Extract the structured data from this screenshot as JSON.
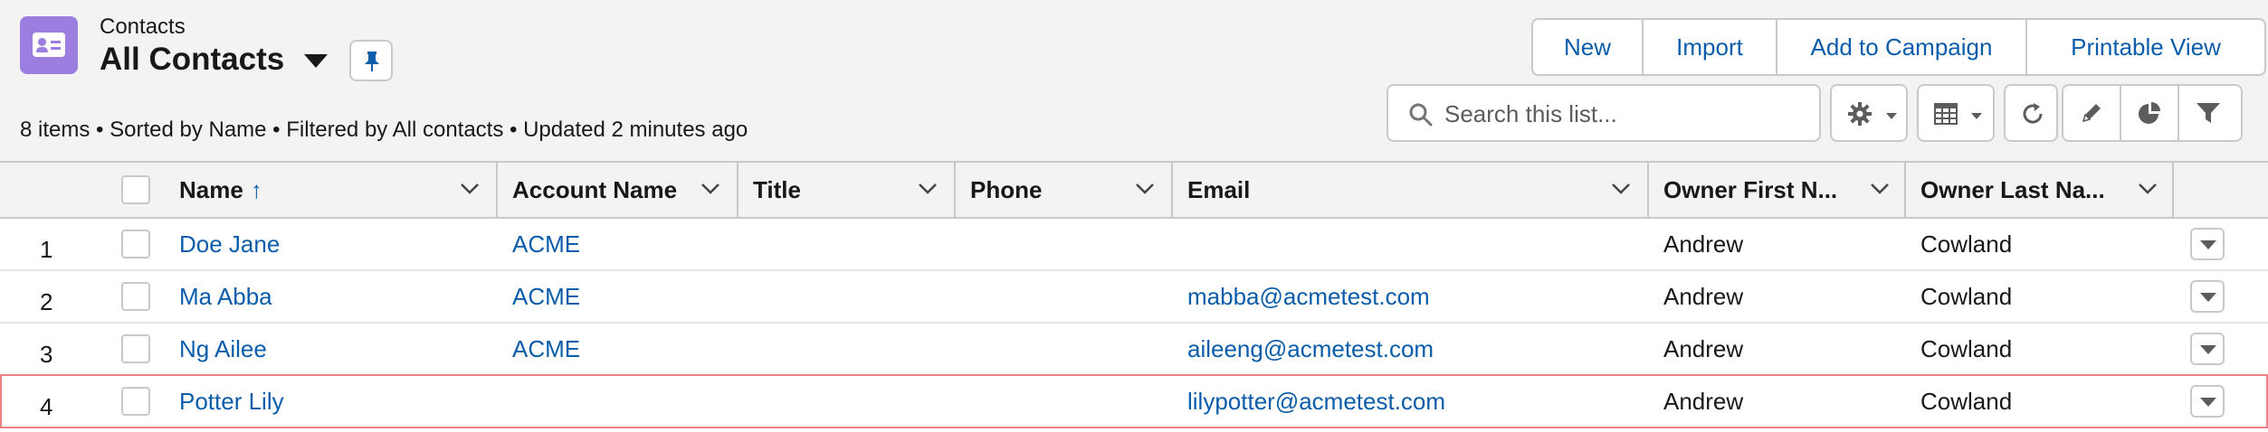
{
  "header": {
    "object_label": "Contacts",
    "list_view_title": "All Contacts",
    "summary": "8 items • Sorted by Name • Filtered by All contacts • Updated 2 minutes ago",
    "buttons": {
      "new": "New",
      "import": "Import",
      "add_to_campaign": "Add to Campaign",
      "printable_view": "Printable View"
    },
    "search_placeholder": "Search this list...",
    "toolbar_icons": [
      "gear-icon",
      "table-icon",
      "refresh-icon",
      "pencil-icon",
      "pie-chart-icon",
      "filter-icon"
    ]
  },
  "table": {
    "columns": {
      "name": "Name",
      "name_sort": "↑",
      "account_name": "Account Name",
      "title": "Title",
      "phone": "Phone",
      "email": "Email",
      "owner_first": "Owner First N...",
      "owner_last": "Owner Last Na..."
    },
    "rows": [
      {
        "num": "1",
        "name": "Doe Jane",
        "account": "ACME",
        "title": "",
        "phone": "",
        "email": "",
        "owner_first": "Andrew",
        "owner_last": "Cowland"
      },
      {
        "num": "2",
        "name": "Ma Abba",
        "account": "ACME",
        "title": "",
        "phone": "",
        "email": "mabba@acmetest.com",
        "owner_first": "Andrew",
        "owner_last": "Cowland"
      },
      {
        "num": "3",
        "name": "Ng Ailee",
        "account": "ACME",
        "title": "",
        "phone": "",
        "email": "aileeng@acmetest.com",
        "owner_first": "Andrew",
        "owner_last": "Cowland"
      },
      {
        "num": "4",
        "name": "Potter Lily",
        "account": "",
        "title": "",
        "phone": "",
        "email": "lilypotter@acmetest.com",
        "owner_first": "Andrew",
        "owner_last": "Cowland"
      }
    ]
  },
  "colors": {
    "link": "#0b5cab",
    "object_icon": "#9b7ee0",
    "selected_row_border": "#ea8288",
    "header_bg": "#f3f3f3"
  }
}
